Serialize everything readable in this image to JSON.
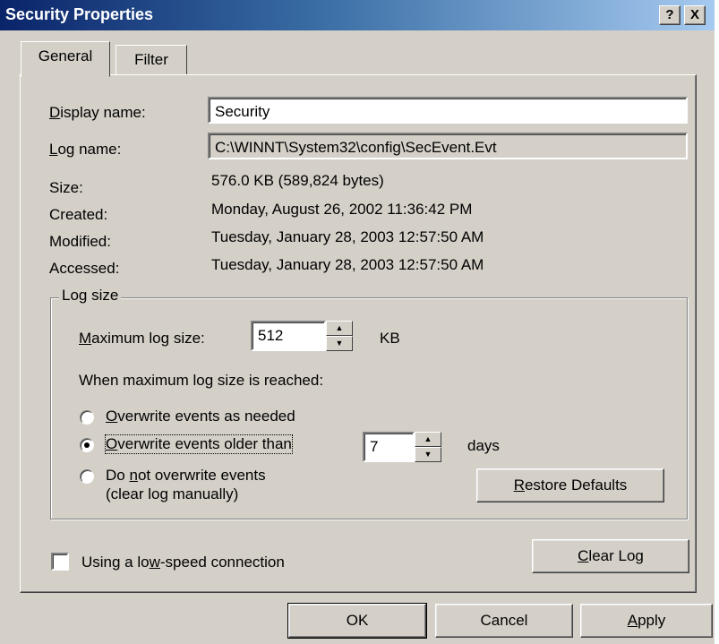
{
  "window": {
    "title": "Security Properties",
    "help_btn": "?",
    "close_btn": "X"
  },
  "tabs": [
    {
      "label": "General",
      "active": true
    },
    {
      "label": "Filter",
      "active": false
    }
  ],
  "general": {
    "display_name_label_u": "D",
    "display_name_label_rest": "isplay name:",
    "display_name_value": "Security",
    "log_name_label_u": "L",
    "log_name_label_rest": "og name:",
    "log_name_value": "C:\\WINNT\\System32\\config\\SecEvent.Evt",
    "size_label": "Size:",
    "size_value": "576.0 KB (589,824 bytes)",
    "created_label": "Created:",
    "created_value": "Monday, August 26, 2002 11:36:42 PM",
    "modified_label": "Modified:",
    "modified_value": "Tuesday, January 28, 2003 12:57:50 AM",
    "accessed_label": "Accessed:",
    "accessed_value": "Tuesday, January 28, 2003 12:57:50 AM"
  },
  "log_size": {
    "group_label": "Log size",
    "max_label_u": "M",
    "max_label_rest": "aximum log size:",
    "max_value": "512",
    "max_unit": "KB",
    "when_label": "When maximum log size is reached:",
    "opt1_u": "O",
    "opt1_rest": "verwrite events as needed",
    "opt2_u": "O",
    "opt2_rest": "verwrite events older than",
    "days_value": "7",
    "days_unit": "days",
    "opt3_pre": "Do ",
    "opt3_u": "n",
    "opt3_rest": "ot overwrite events",
    "opt3_line2": "(clear log manually)",
    "selected_option": 2,
    "restore_u": "R",
    "restore_rest": "estore Defaults"
  },
  "footer": {
    "lowspeed_pre": "Using a lo",
    "lowspeed_u": "w",
    "lowspeed_rest": "-speed connection",
    "lowspeed_checked": false,
    "clear_u": "C",
    "clear_rest": "lear Log"
  },
  "buttons": {
    "ok": "OK",
    "cancel": "Cancel",
    "apply_u": "A",
    "apply_rest": "pply"
  }
}
